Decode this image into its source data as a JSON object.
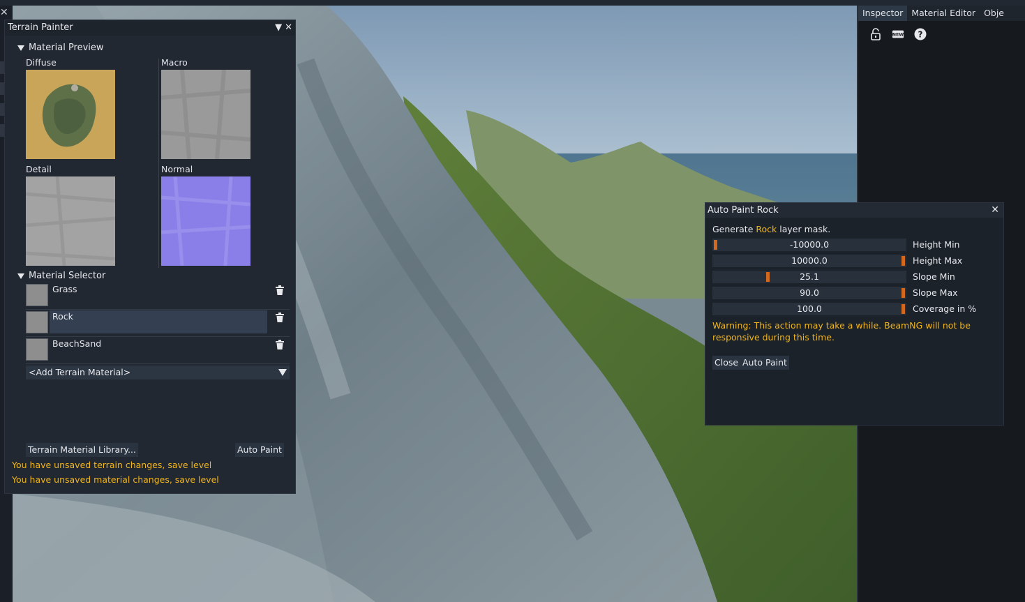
{
  "colors": {
    "accent": "#f0b51e",
    "knob": "#d2691e",
    "selected_row": "#344052"
  },
  "terrain_painter": {
    "title": "Terrain Painter",
    "material_preview": {
      "header": "Material Preview",
      "diffuse": "Diffuse",
      "macro": "Macro",
      "detail": "Detail",
      "normal": "Normal"
    },
    "material_selector": {
      "header": "Material Selector",
      "items": [
        {
          "name": "Grass",
          "selected": false
        },
        {
          "name": "Rock",
          "selected": true
        },
        {
          "name": "BeachSand",
          "selected": false
        }
      ],
      "add_placeholder": "<Add Terrain Material>"
    },
    "library_button": "Terrain Material Library...",
    "auto_paint_button": "Auto Paint",
    "warnings": [
      "You have unsaved terrain changes, save level",
      "You have unsaved material changes, save level"
    ]
  },
  "inspector": {
    "tabs": [
      "Inspector",
      "Material Editor",
      "Obje"
    ],
    "active_tab": "Inspector",
    "icons": [
      "lock-icon",
      "new-icon",
      "help-icon"
    ]
  },
  "auto_paint": {
    "title": "Auto Paint Rock",
    "generate_prefix": "Generate",
    "material": "Rock",
    "generate_suffix": "layer mask.",
    "sliders": [
      {
        "label": "Height Min",
        "value": "-10000.0",
        "fraction": 0.0
      },
      {
        "label": "Height Max",
        "value": "10000.0",
        "fraction": 1.0
      },
      {
        "label": "Slope Min",
        "value": "25.1",
        "fraction": 0.28
      },
      {
        "label": "Slope Max",
        "value": "90.0",
        "fraction": 1.0
      },
      {
        "label": "Coverage in %",
        "value": "100.0",
        "fraction": 1.0
      }
    ],
    "warning": "Warning: This action may take a while. BeamNG will not be responsive during this time.",
    "close_button": "Close",
    "auto_paint_button": "Auto Paint"
  }
}
